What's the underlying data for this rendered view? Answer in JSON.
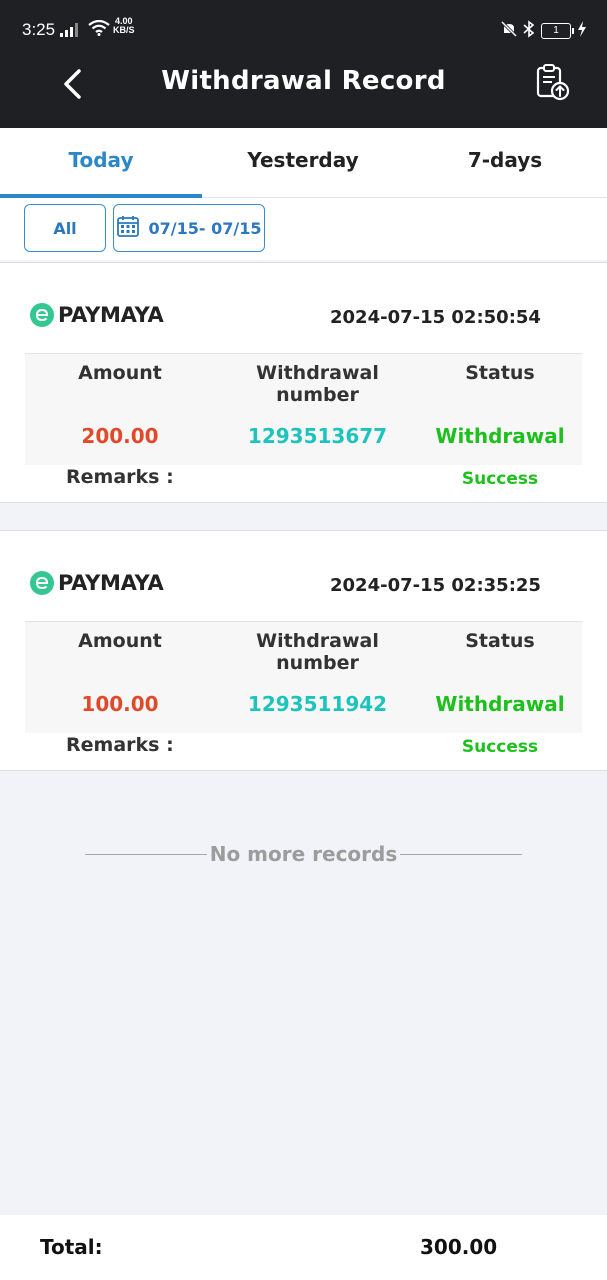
{
  "status_bar": {
    "time": "3:25",
    "net_speed_value": "4.00",
    "net_speed_unit": "KB/S",
    "battery": "1"
  },
  "header": {
    "title": "Withdrawal Record",
    "back_icon": "chevron-left-icon",
    "action_icon": "clipboard-upload-icon"
  },
  "tabs": [
    {
      "label": "Today",
      "active": true
    },
    {
      "label": "Yesterday",
      "active": false
    },
    {
      "label": "7-days",
      "active": false
    }
  ],
  "filters": {
    "type_label": "All",
    "date_range": "07/15- 07/15"
  },
  "records": [
    {
      "method": "PAYMAYA",
      "datetime": "2024-07-15 02:50:54",
      "amount_header": "Amount",
      "number_header": "Withdrawal number",
      "status_header": "Status",
      "amount": "200.00",
      "number": "1293513677",
      "status": "Withdrawal",
      "remarks_label": "Remarks :",
      "result": "Success"
    },
    {
      "method": "PAYMAYA",
      "datetime": "2024-07-15 02:35:25",
      "amount_header": "Amount",
      "number_header": "Withdrawal number",
      "status_header": "Status",
      "amount": "100.00",
      "number": "1293511942",
      "status": "Withdrawal",
      "remarks_label": "Remarks :",
      "result": "Success"
    }
  ],
  "no_more": "No more records",
  "footer": {
    "total_label": "Total:",
    "total_value": "300.00"
  },
  "colors": {
    "header_bg": "#1e2024",
    "accent": "#2b88c8",
    "amount": "#e04a2a",
    "number": "#1ec3bd",
    "success": "#1ec01e"
  }
}
